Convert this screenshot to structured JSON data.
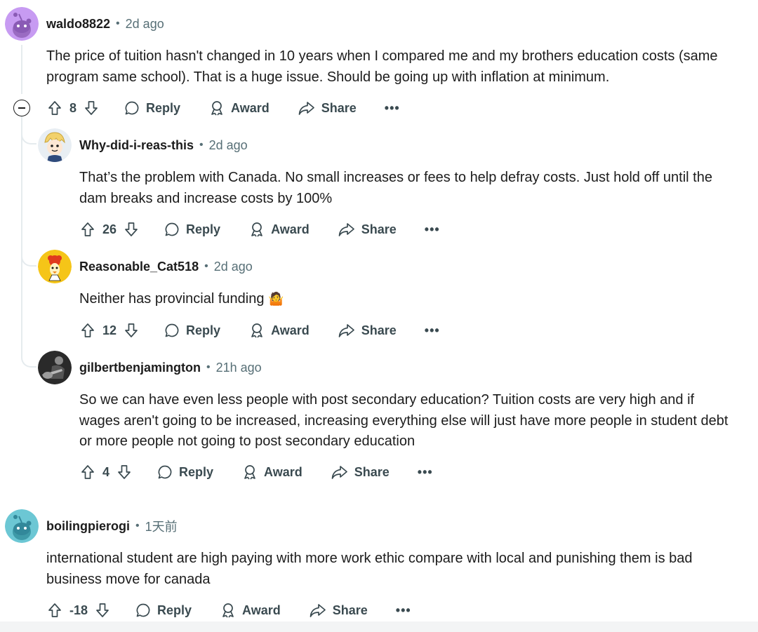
{
  "comments": [
    {
      "username": "waldo8822",
      "time": "2d ago",
      "body": "The price of tuition hasn't changed in 10 years when I compared me and my brothers education costs (same program same school). That is a huge issue. Should be going up with inflation at minimum.",
      "votes": "8",
      "avatar": "reddit-snoo-purple",
      "avatar_color": "#c79bf2"
    },
    {
      "username": "Why-did-i-reas-this",
      "time": "2d ago",
      "body": "That’s the problem with Canada. No small increases or fees to help defray costs. Just hold off until the dam breaks and increase costs by 100%",
      "votes": "26",
      "avatar": "cartoon-character-yellow-hair"
    },
    {
      "username": "Reasonable_Cat518",
      "time": "2d ago",
      "body": "Neither has provincial funding",
      "emoji": "🤷",
      "votes": "12",
      "avatar": "cartoon-rooster",
      "avatar_color": "#f5c518"
    },
    {
      "username": "gilbertbenjamington",
      "time": "21h ago",
      "body": "So we can have even less people with post secondary education? Tuition costs are very high and if wages aren't going to be increased, increasing everything else will just have more people in student debt or more people not going to post secondary education",
      "votes": "4",
      "avatar": "photo-person-guitar"
    },
    {
      "username": "boilingpierogi",
      "time": "1天前",
      "body": "international student are high paying with more work ethic compare with local and punishing them is bad business move for canada",
      "votes": "-18",
      "avatar": "reddit-snoo-teal",
      "avatar_color": "#6cc7d4"
    }
  ],
  "actions": {
    "reply": "Reply",
    "award": "Award",
    "share": "Share",
    "more": "•••"
  },
  "colors": {
    "text": "#1c1c1c",
    "meta": "#576f76",
    "action": "#3a4a50",
    "thread_line": "#e5ebee"
  }
}
